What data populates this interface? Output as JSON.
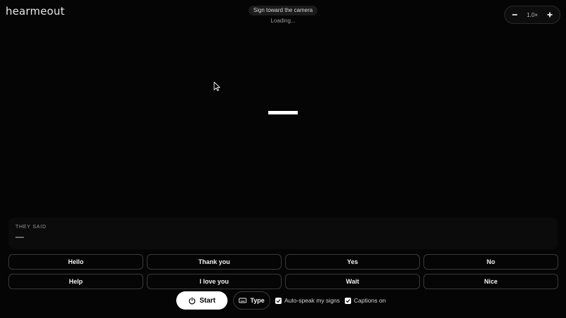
{
  "app": {
    "logo": "hearmeout"
  },
  "header": {
    "hint": "Sign toward the camera",
    "status": "Loading..."
  },
  "zoom": {
    "value": "1.0×",
    "decrease_icon": "minus-icon",
    "increase_icon": "plus-icon"
  },
  "caption": {
    "label": "THEY SAID",
    "text": "—"
  },
  "phrases": [
    {
      "label": "Hello"
    },
    {
      "label": "Thank you"
    },
    {
      "label": "Yes"
    },
    {
      "label": "No"
    },
    {
      "label": "Help"
    },
    {
      "label": "I love you"
    },
    {
      "label": "Wait"
    },
    {
      "label": "Nice"
    }
  ],
  "controls": {
    "start_label": "Start",
    "start_icon": "power-icon",
    "type_label": "Type",
    "type_icon": "keyboard-icon",
    "auto_speak": {
      "label": "Auto-speak my signs",
      "checked": true
    },
    "captions": {
      "label": "Captions on",
      "checked": true
    }
  },
  "colors": {
    "background": "#050505",
    "accent": "#ffffff"
  }
}
